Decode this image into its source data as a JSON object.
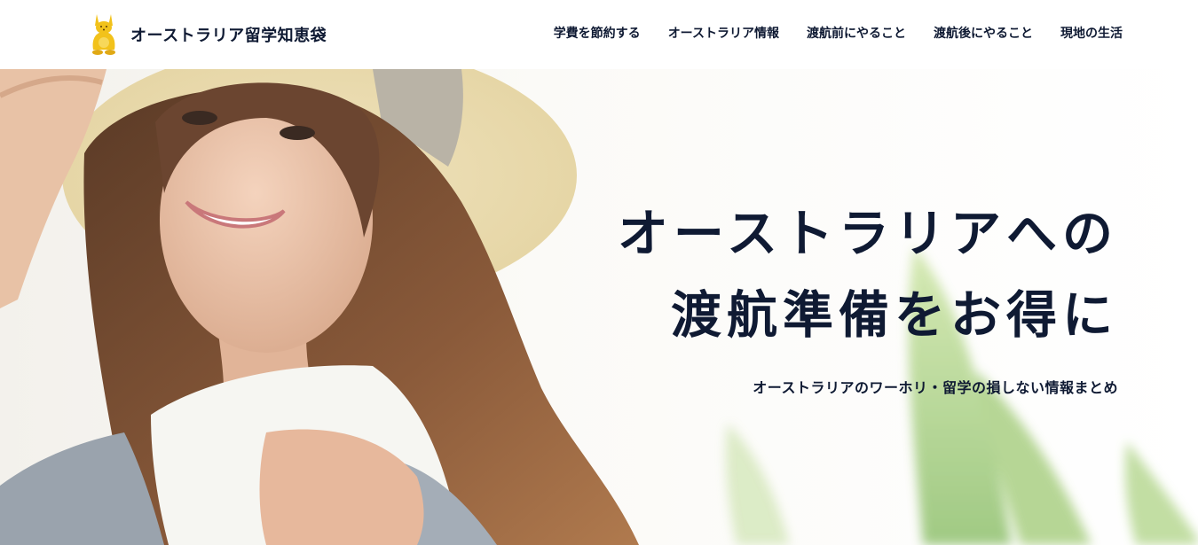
{
  "site": {
    "name": "オーストラリア留学知恵袋",
    "logo_icon": "kangaroo-icon"
  },
  "nav": {
    "items": [
      {
        "label": "学費を節約する"
      },
      {
        "label": "オーストラリア情報"
      },
      {
        "label": "渡航前にやること"
      },
      {
        "label": "渡航後にやること"
      },
      {
        "label": "現地の生活"
      }
    ]
  },
  "hero": {
    "title_line1": "オーストラリアへの",
    "title_line2": "渡航準備をお得に",
    "subtitle": "オーストラリアのワーホリ・留学の損しない情報まとめ"
  },
  "colors": {
    "text": "#0f1a33",
    "logo_yellow": "#f2c21b",
    "background": "#ffffff"
  }
}
